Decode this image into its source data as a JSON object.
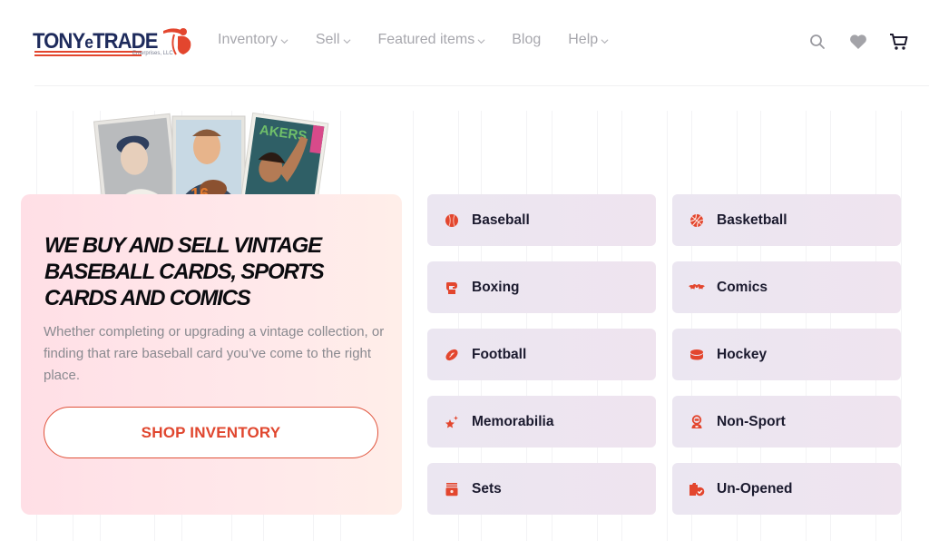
{
  "header": {
    "logo": {
      "name": "TONYeTRADE",
      "brand_main": "TONY",
      "brand_e": "e",
      "brand_end": "TRADE",
      "subtitle": "Enterprises, LLC"
    },
    "nav": [
      {
        "label": "Inventory",
        "has_dropdown": true
      },
      {
        "label": "Sell",
        "has_dropdown": true
      },
      {
        "label": "Featured items",
        "has_dropdown": true
      },
      {
        "label": "Blog",
        "has_dropdown": false
      },
      {
        "label": "Help",
        "has_dropdown": true
      }
    ],
    "icons": [
      "search-icon",
      "heart-icon",
      "cart-icon"
    ]
  },
  "hero": {
    "image_alt": "Vintage sports trading cards",
    "title": "We buy and sell vintage baseball cards, sports cards and comics",
    "description": "Whether completing or upgrading a vintage collection, or finding that rare baseball card you’ve come to the right place.",
    "button_label": "SHOP INVENTORY"
  },
  "categories": [
    {
      "label": "Baseball",
      "icon": "baseball-icon"
    },
    {
      "label": "Basketball",
      "icon": "basketball-icon"
    },
    {
      "label": "Boxing",
      "icon": "boxing-glove-icon"
    },
    {
      "label": "Comics",
      "icon": "bat-icon"
    },
    {
      "label": "Football",
      "icon": "football-icon"
    },
    {
      "label": "Hockey",
      "icon": "hockey-puck-icon"
    },
    {
      "label": "Memorabilia",
      "icon": "star-sparkle-icon"
    },
    {
      "label": "Non-Sport",
      "icon": "astronaut-icon"
    },
    {
      "label": "Sets",
      "icon": "card-box-icon"
    },
    {
      "label": "Un-Opened",
      "icon": "sealed-box-check-icon"
    }
  ],
  "colors": {
    "accent": "#e3462e",
    "navy": "#1e2b5c",
    "nav_text": "#a7a7ad",
    "hero_bg_start": "#ffdfe6",
    "hero_bg_end": "#ffeee9",
    "category_bg_start": "#ebe6f1",
    "category_bg_end": "#efe4ef"
  }
}
